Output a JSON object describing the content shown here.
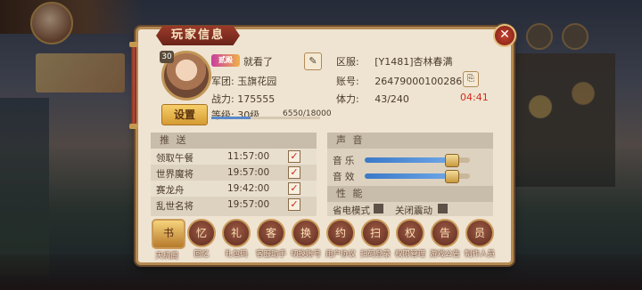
{
  "dialog": {
    "title": "玩家信息",
    "close": "✕"
  },
  "profile": {
    "level_badge": "30",
    "vip": "贰殿",
    "name": "就看了",
    "edit_icon": "✎",
    "guild_label": "军团:",
    "guild": "玉旗花园",
    "power_label": "战力:",
    "power": "175555",
    "level_label": "等级:",
    "level": "30级",
    "exp": "6550/18000",
    "exp_progress": 0.364,
    "settings": "设置"
  },
  "account": {
    "server_label": "区服:",
    "server": "[Y1481]杏林春满",
    "account_label": "账号:",
    "account": "264790001002863",
    "copy_icon": "⎘",
    "stamina_label": "体力:",
    "stamina": "43/240",
    "timer": "04:41"
  },
  "push": {
    "title": "推 送",
    "rows": [
      {
        "name": "领取午餐",
        "time": "11:57:00",
        "checked": "✓"
      },
      {
        "name": "世界魔将",
        "time": "19:57:00",
        "checked": "✓"
      },
      {
        "name": "赛龙舟",
        "time": "19:42:00",
        "checked": "✓"
      },
      {
        "name": "乱世名将",
        "time": "19:57:00",
        "checked": "✓"
      }
    ]
  },
  "sound": {
    "title": "声 音",
    "music_label": "音 乐",
    "music_level": 0.82,
    "effect_label": "音 效",
    "effect_level": 0.82
  },
  "performance": {
    "title": "性 能",
    "power_save": "省电模式",
    "vibration_off": "关闭震动"
  },
  "bottom_buttons": [
    {
      "label": "天机阁",
      "icon": "书"
    },
    {
      "label": "回忆",
      "icon": "忆"
    },
    {
      "label": "礼包码",
      "icon": "礼"
    },
    {
      "label": "客服助手",
      "icon": "客"
    },
    {
      "label": "切换账号",
      "icon": "换"
    },
    {
      "label": "用户协议",
      "icon": "约"
    },
    {
      "label": "扫码登录",
      "icon": "扫"
    },
    {
      "label": "权限管理",
      "icon": "权"
    },
    {
      "label": "游戏公告",
      "icon": "告"
    },
    {
      "label": "制作人员",
      "icon": "员"
    }
  ]
}
